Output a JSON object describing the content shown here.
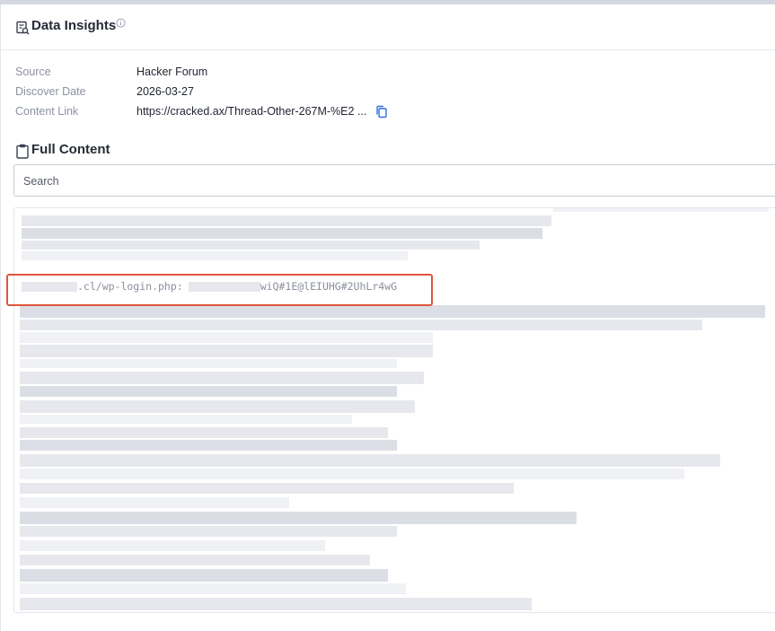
{
  "header": {
    "title": "Data Insights",
    "title_icon": "document-search-icon",
    "info_icon": "info-circle-icon"
  },
  "meta": {
    "source_label": "Source",
    "source_value": "Hacker Forum",
    "date_label": "Discover Date",
    "date_value": "2026-03-27",
    "link_label": "Content Link",
    "link_value": "https://cracked.ax/Thread-Other-267M-%E2 ...",
    "copy_icon": "copy-icon"
  },
  "full_content": {
    "title": "Full Content",
    "title_icon": "clipboard-icon",
    "search_placeholder": "Search",
    "line_part1": ".cl/wp-login.php:",
    "line_part2": "wiQ#1E@lEIUHG#2UhLr4wG"
  },
  "colors": {
    "highlight": "#e0563a",
    "accent": "#2f6fe4"
  }
}
